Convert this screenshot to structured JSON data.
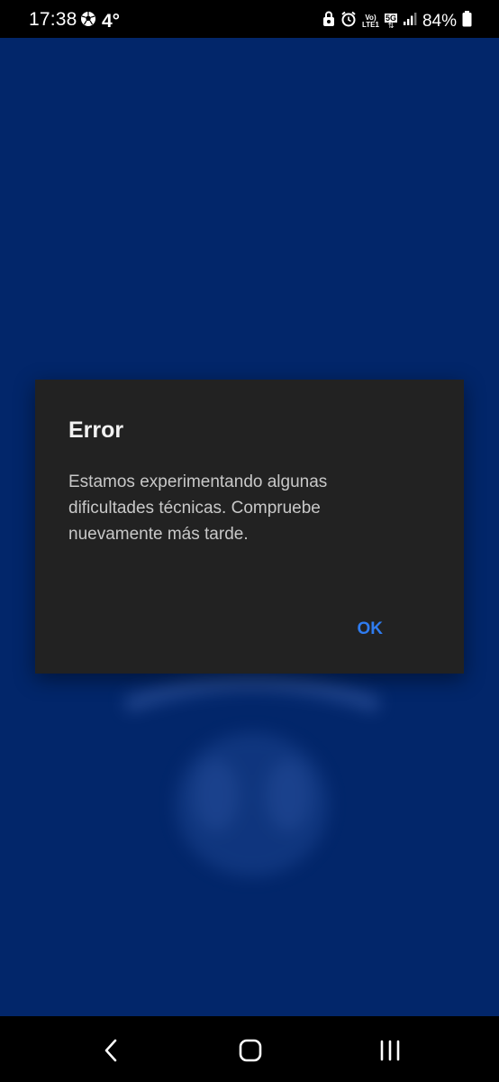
{
  "status_bar": {
    "time": "17:38",
    "temperature": "4°",
    "network_top": "Vo)",
    "network_bottom": "LTE1",
    "network_type": "5G",
    "battery": "84%"
  },
  "dialog": {
    "title": "Error",
    "message": "Estamos experimentando algunas dificultades técnicas. Compruebe nuevamente más tarde.",
    "ok_label": "OK"
  },
  "colors": {
    "app_background": "#02266a",
    "dialog_background": "#222222",
    "accent": "#2f7cf0"
  },
  "icons": {
    "status_left": [
      "soccer-ball-icon"
    ],
    "status_right": [
      "lock-icon",
      "alarm-icon",
      "signal-icon",
      "battery-icon"
    ],
    "nav": [
      "back-icon",
      "home-icon",
      "recents-icon"
    ]
  }
}
